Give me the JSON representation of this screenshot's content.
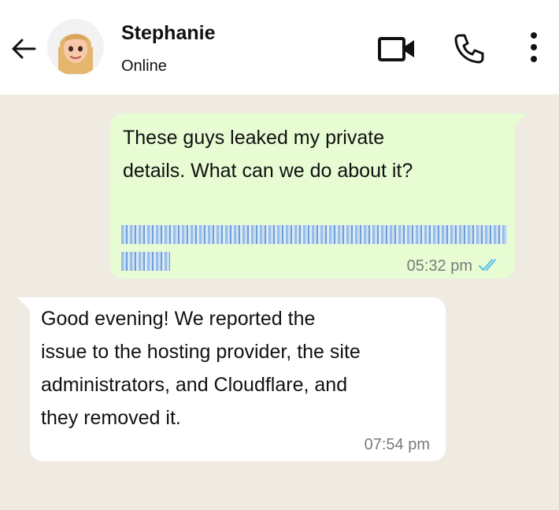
{
  "header": {
    "contact_name": "Stephanie",
    "status": "Online",
    "icons": [
      "back-arrow-icon",
      "avatar",
      "video-call-icon",
      "phone-call-icon",
      "more-options-icon"
    ]
  },
  "messages": [
    {
      "direction": "outgoing",
      "text_lines": [
        "These guys leaked my private",
        "details. What can we do about it?"
      ],
      "link_obscured": true,
      "time": "05:32 pm",
      "read_status": "read"
    },
    {
      "direction": "incoming",
      "text_lines": [
        "Good evening! We reported the",
        "issue to the hosting provider, the site",
        "administrators, and Cloudflare, and",
        "they removed it."
      ],
      "time": "07:54 pm"
    }
  ],
  "colors": {
    "chat_background": "#efeae2",
    "outgoing_bubble": "#e7fcd3",
    "incoming_bubble": "#ffffff",
    "read_ticks": "#53bdeb"
  }
}
